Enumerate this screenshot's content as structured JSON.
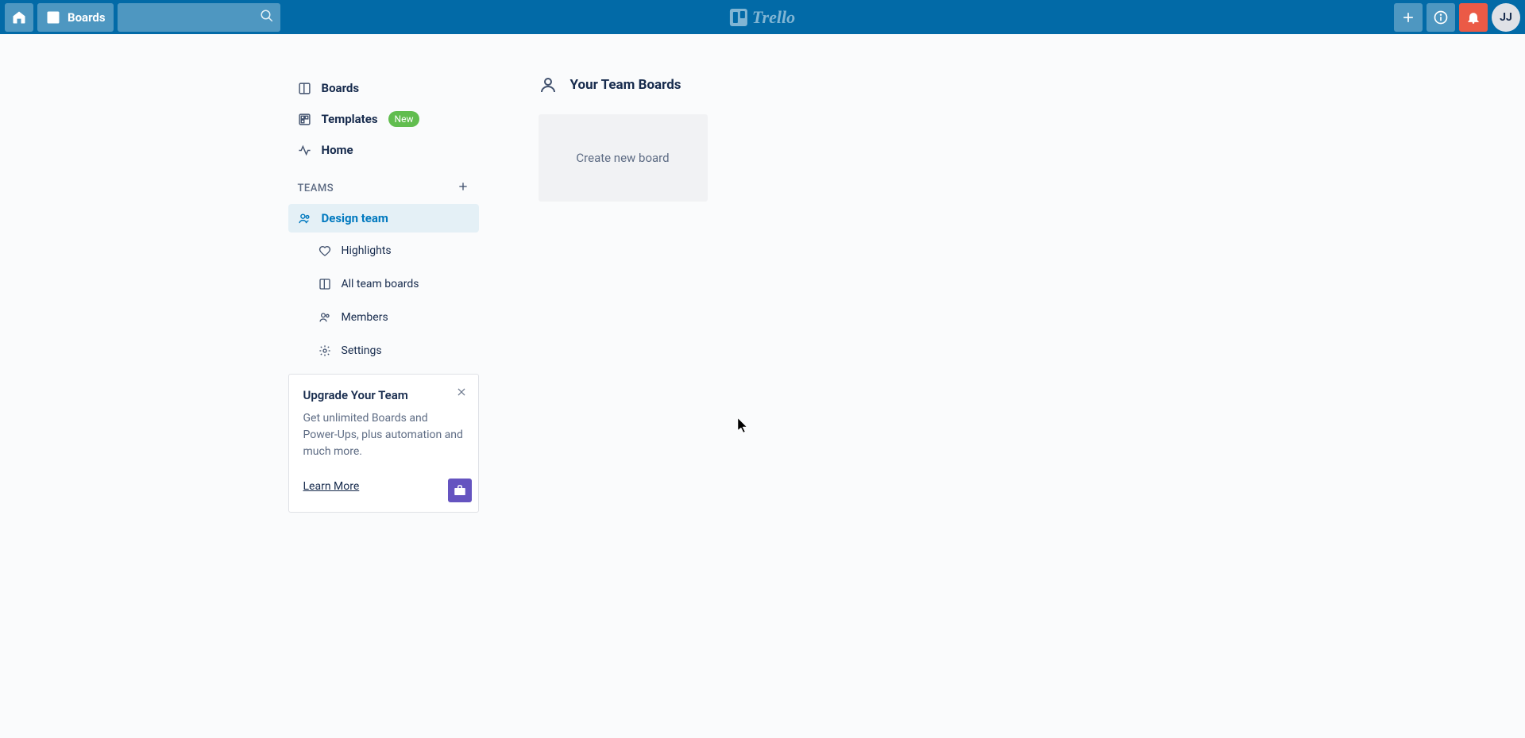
{
  "topbar": {
    "boards_label": "Boards",
    "logo_text": "Trello",
    "avatar_initials": "JJ"
  },
  "sidebar": {
    "nav": {
      "boards": "Boards",
      "templates": "Templates",
      "templates_badge": "New",
      "home": "Home"
    },
    "teams_label": "TEAMS",
    "team_name": "Design team",
    "sub": {
      "highlights": "Highlights",
      "all_boards": "All team boards",
      "members": "Members",
      "settings": "Settings"
    },
    "upgrade": {
      "title": "Upgrade Your Team",
      "text": "Get unlimited Boards and Power-Ups, plus automation and much more.",
      "link": "Learn More"
    }
  },
  "main": {
    "title": "Your Team Boards",
    "create_board": "Create new board"
  }
}
